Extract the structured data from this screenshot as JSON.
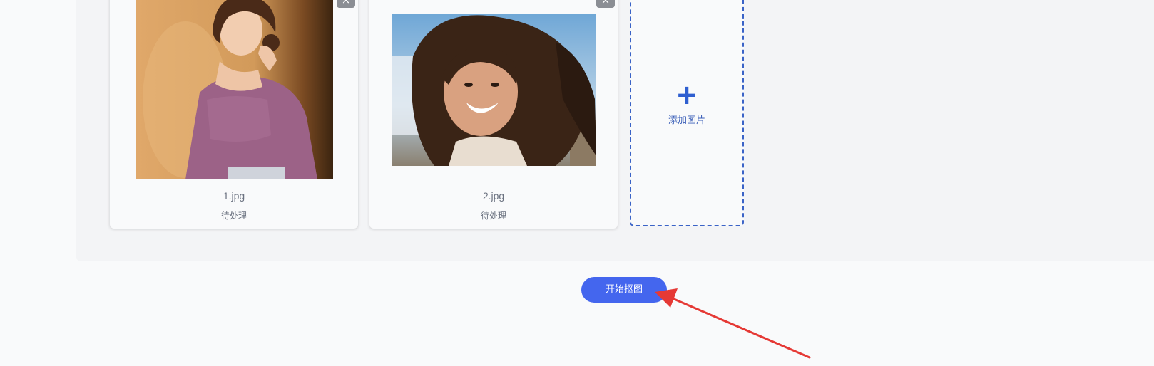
{
  "images": [
    {
      "filename": "1.jpg",
      "status": "待处理",
      "remove_glyph": "×"
    },
    {
      "filename": "2.jpg",
      "status": "待处理",
      "remove_glyph": "×"
    }
  ],
  "add_tile": {
    "icon": "plus-icon",
    "plus_glyph": "+",
    "label": "添加图片"
  },
  "start_button": {
    "label": "开始抠图"
  },
  "colors": {
    "accent": "#4466ee",
    "add_border": "#3a63c7",
    "annotation_arrow": "#e53935"
  }
}
